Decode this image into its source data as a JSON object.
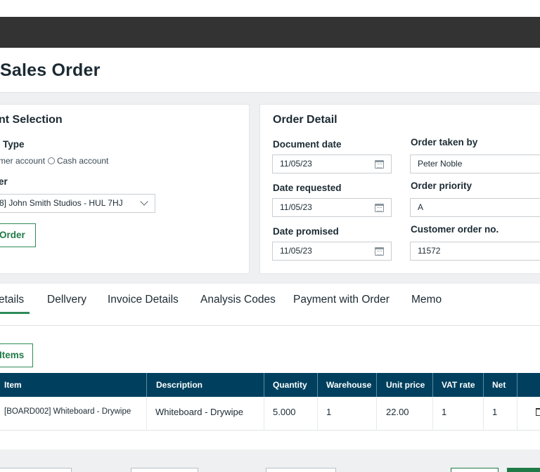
{
  "page": {
    "title": "Sales Order"
  },
  "account_selection": {
    "heading": "nt Selection",
    "type_label": "Type",
    "radio_customer": "mer account",
    "radio_cash": "Cash account",
    "customer_label": "er",
    "customer_value": "8] John Smith Studios - HUL 7HJ",
    "order_button": "Order"
  },
  "order_detail": {
    "heading": "Order Detail",
    "document_date_label": "Document date",
    "document_date": "11/05/23",
    "date_requested_label": "Date requested",
    "date_requested": "11/05/23",
    "date_promised_label": "Date promised",
    "date_promised": "11/05/23",
    "order_taken_by_label": "Order taken by",
    "order_taken_by": "Peter Noble",
    "order_priority_label": "Order priority",
    "order_priority": "A",
    "customer_order_no_label": "Customer order no.",
    "customer_order_no": "11572"
  },
  "tabs": [
    {
      "label": "etails",
      "active": true
    },
    {
      "label": "Dellvery"
    },
    {
      "label": "Invoice Details"
    },
    {
      "label": "Analysis Codes"
    },
    {
      "label": "Payment with Order"
    },
    {
      "label": "Memo"
    }
  ],
  "items_button": "Items",
  "table": {
    "headers": [
      "Item",
      "Description",
      "Quantity",
      "Warehouse",
      "Unit price",
      "VAT rate",
      "Net"
    ],
    "rows": [
      {
        "item": "[BOARD002] Whiteboard - Drywipe",
        "description": "Whiteboard - Drywipe",
        "quantity": "5.000",
        "warehouse": "1",
        "unit_price": "22.00",
        "vat_rate": "1",
        "net": "1"
      }
    ]
  },
  "colors": {
    "accent": "#2e8b57",
    "table_header": "#00405e",
    "app_bar": "#333333"
  }
}
